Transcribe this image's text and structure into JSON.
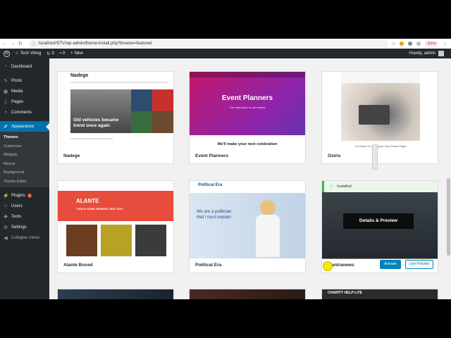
{
  "browser": {
    "url": "localhost/STV/wp-admin/theme-install.php?browse=featured",
    "error_label": "Error"
  },
  "admin_bar": {
    "site_name": "Tech Vblog",
    "updates_count": "3",
    "comments_count": "0",
    "new_label": "New",
    "howdy": "Howdy, admin"
  },
  "sidebar": {
    "items": [
      {
        "label": "Dashboard"
      },
      {
        "label": "Posts"
      },
      {
        "label": "Media"
      },
      {
        "label": "Pages"
      },
      {
        "label": "Comments"
      },
      {
        "label": "Appearance"
      }
    ],
    "appearance_sub": [
      {
        "label": "Themes"
      },
      {
        "label": "Customize"
      },
      {
        "label": "Widgets"
      },
      {
        "label": "Menus"
      },
      {
        "label": "Background"
      },
      {
        "label": "Theme Editor"
      }
    ],
    "bottom_items": [
      {
        "label": "Plugins",
        "badge": "1"
      },
      {
        "label": "Users"
      },
      {
        "label": "Tools"
      },
      {
        "label": "Settings"
      },
      {
        "label": "Collapse menu"
      }
    ]
  },
  "themes": [
    {
      "name": "Nadege",
      "shot_title": "Nadege",
      "shot_text": "Old vehicles became trend once again"
    },
    {
      "name": "Event Planners",
      "shot_title": "Event Planners",
      "shot_sub": "The best place to get started",
      "shot_text": "We'll make your next celebration"
    },
    {
      "name": "Osiris",
      "shot_text": "You Need To Configure Your Home Page!"
    },
    {
      "name": "Alante Boxed",
      "shot_title": "ALANTE",
      "shot_sub": "THIS IS SOME GENERIC SEO TEXT"
    },
    {
      "name": "Political Era",
      "shot_title": "Political Era",
      "shot_text": "We are a politician that I must explain"
    },
    {
      "name": "Mantranews",
      "installed": "Installed",
      "details": "Details & Preview",
      "activate": "Activate",
      "live_preview": "Live Preview"
    }
  ],
  "bottom_row_text": "CHARITY HELP LITE",
  "colors": {
    "wp_blue": "#0073aa",
    "admin_dark": "#23282d",
    "installed_green": "#46b450"
  }
}
